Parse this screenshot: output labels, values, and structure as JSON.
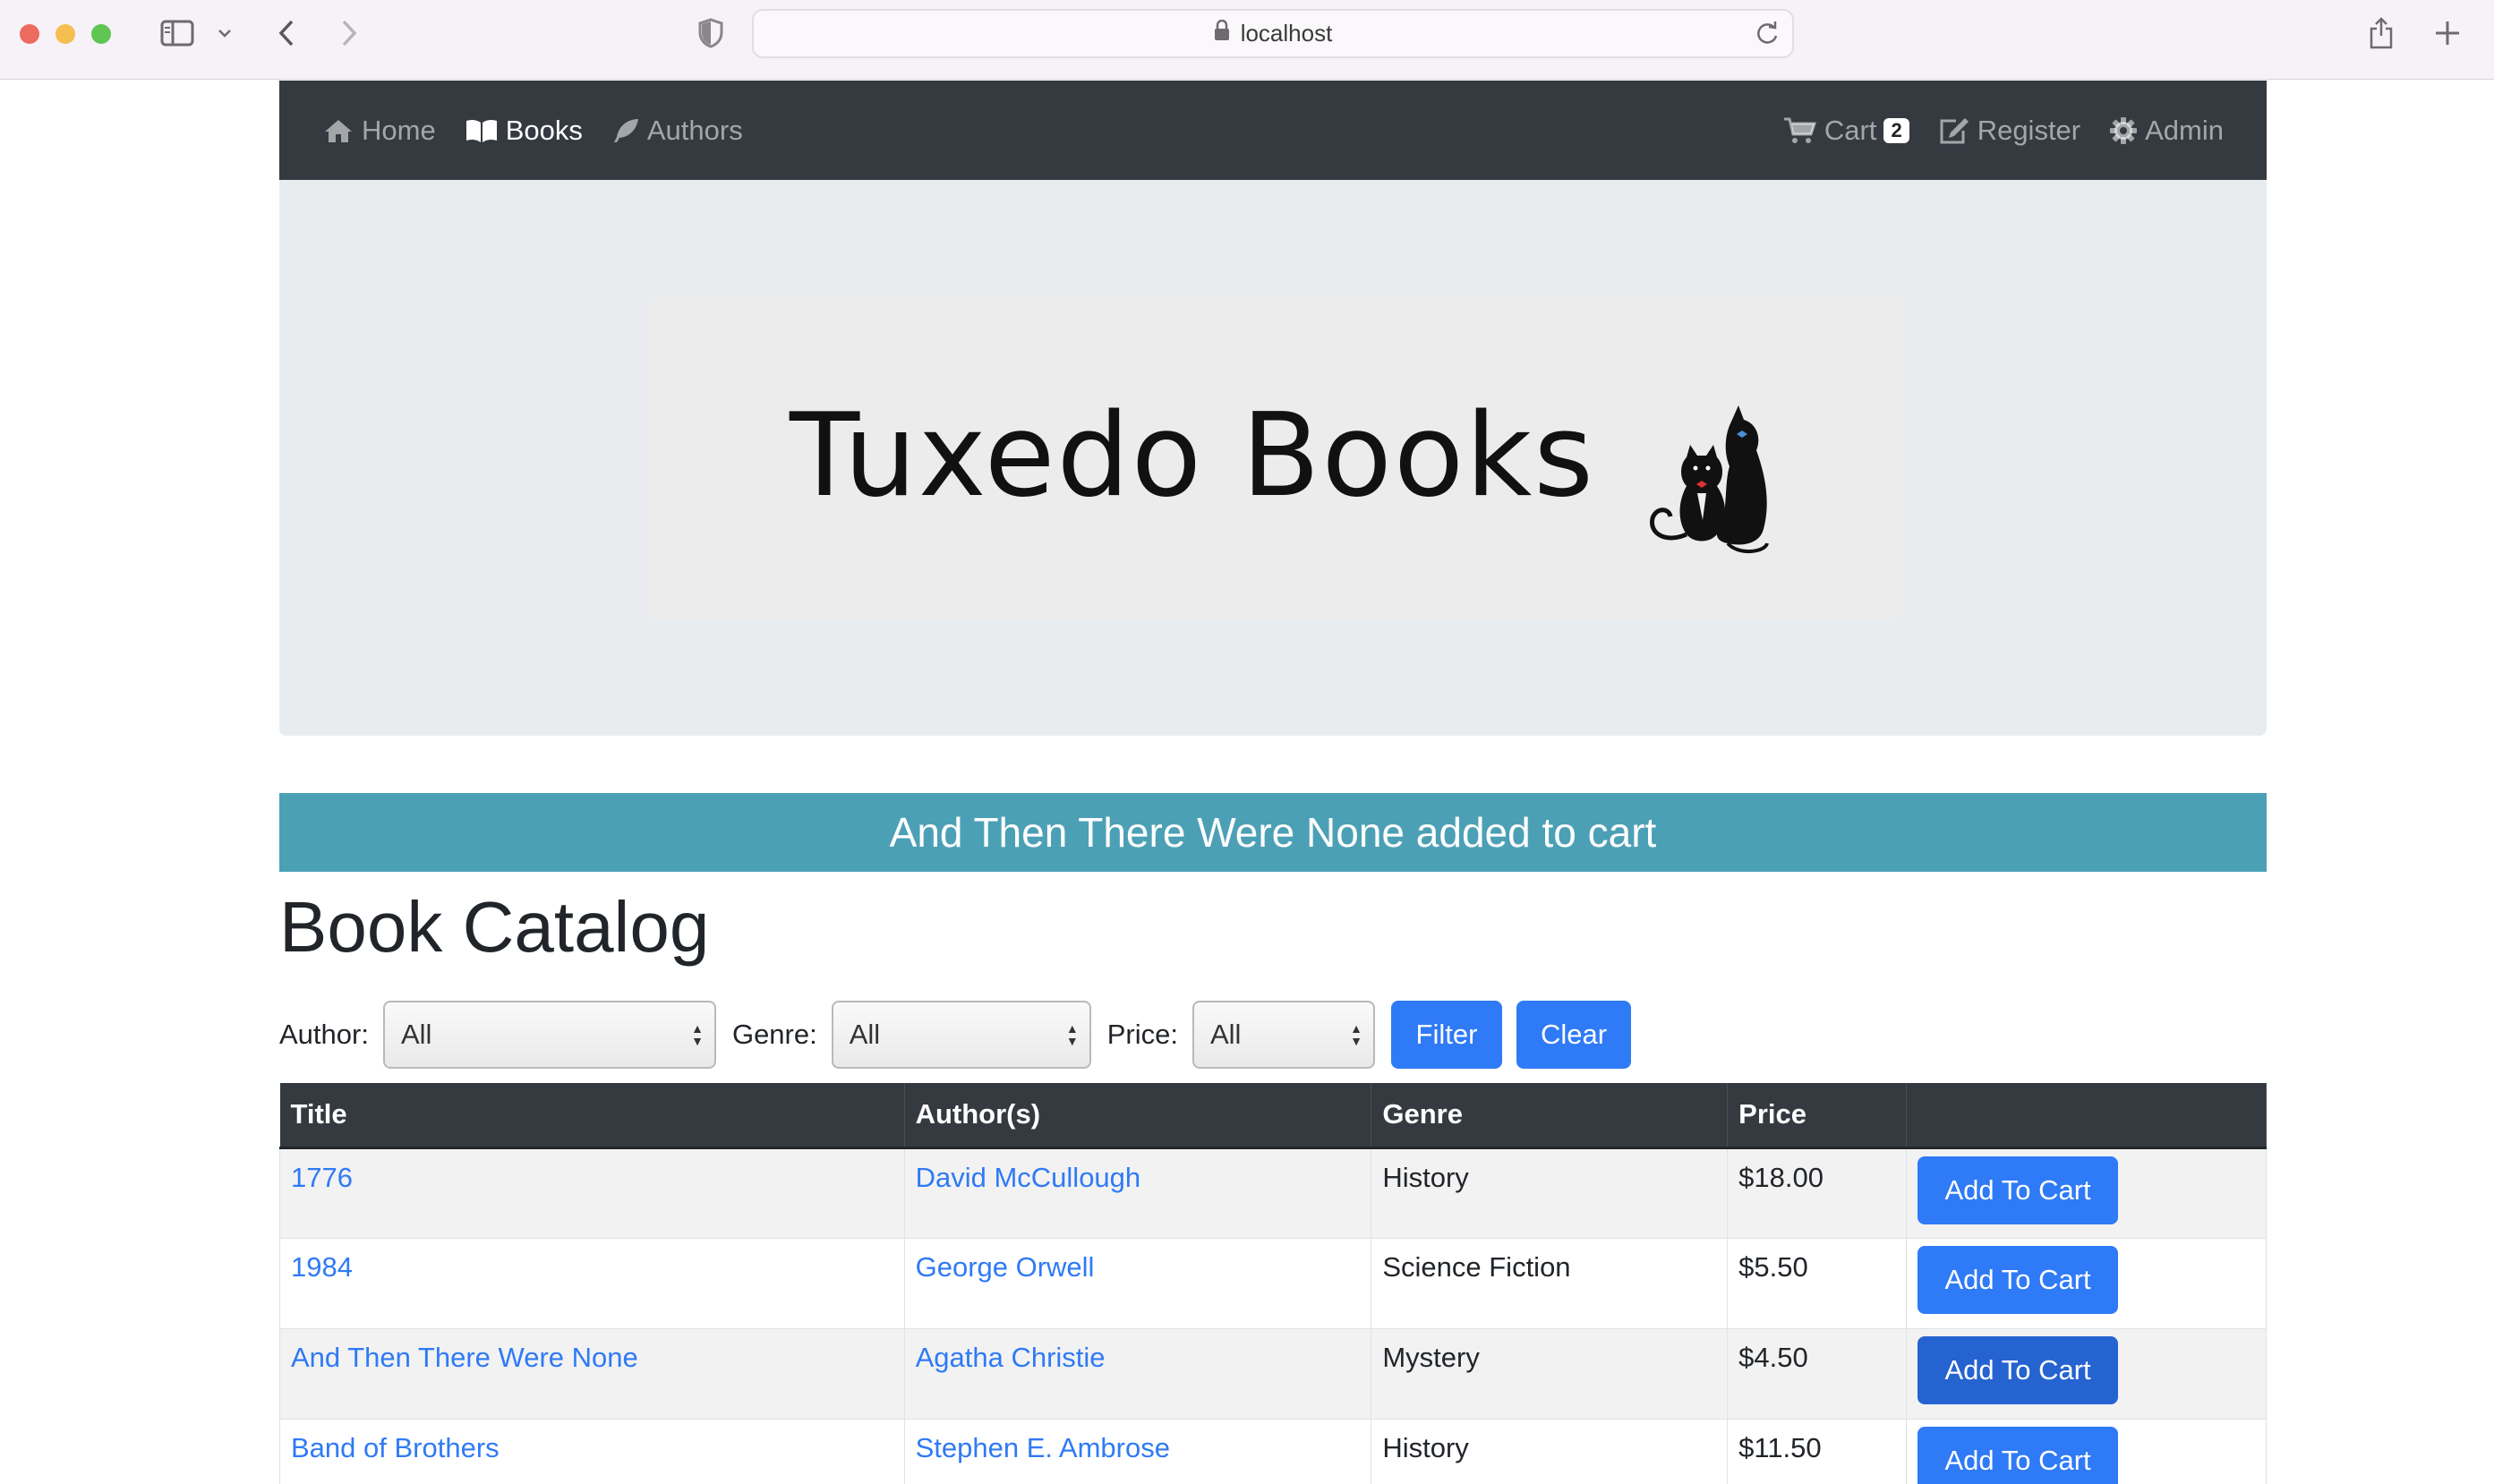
{
  "browser": {
    "url": "localhost"
  },
  "nav": {
    "left": [
      {
        "label": "Home",
        "icon": "home-icon",
        "active": false
      },
      {
        "label": "Books",
        "icon": "book-icon",
        "active": true
      },
      {
        "label": "Authors",
        "icon": "feather-icon",
        "active": false
      }
    ],
    "right": [
      {
        "label": "Cart",
        "icon": "cart-icon",
        "badge": "2"
      },
      {
        "label": "Register",
        "icon": "edit-icon"
      },
      {
        "label": "Admin",
        "icon": "gear-icon"
      }
    ]
  },
  "brand": {
    "logo_text": "Tuxedo Books"
  },
  "alert": {
    "message": "And Then There Were None added to cart",
    "color": "#4ca0b6"
  },
  "page": {
    "title": "Book Catalog"
  },
  "filters": {
    "author_label": "Author:",
    "author_value": "All",
    "genre_label": "Genre:",
    "genre_value": "All",
    "price_label": "Price:",
    "price_value": "All",
    "filter_button": "Filter",
    "clear_button": "Clear"
  },
  "table": {
    "headers": [
      "Title",
      "Author(s)",
      "Genre",
      "Price",
      ""
    ],
    "rows": [
      {
        "title": "1776",
        "author": "David McCullough",
        "genre": "History",
        "price": "$18.00",
        "action": "Add To Cart"
      },
      {
        "title": "1984",
        "author": "George Orwell",
        "genre": "Science Fiction",
        "price": "$5.50",
        "action": "Add To Cart"
      },
      {
        "title": "And Then There Were None",
        "author": "Agatha Christie",
        "genre": "Mystery",
        "price": "$4.50",
        "action": "Add To Cart"
      },
      {
        "title": "Band of Brothers",
        "author": "Stephen E. Ambrose",
        "genre": "History",
        "price": "$11.50",
        "action": "Add To Cart"
      }
    ]
  },
  "colors": {
    "navbar": "#343a40",
    "primary": "#2f7af6",
    "jumbotron": "#e9ecef"
  }
}
